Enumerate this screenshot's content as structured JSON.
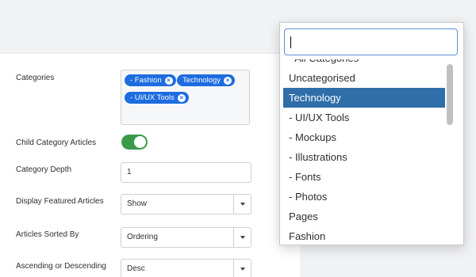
{
  "form": {
    "categories_label": "Categories",
    "tags": [
      {
        "label": "- Fashion"
      },
      {
        "label": "Technology"
      },
      {
        "label": "- UI/UX Tools"
      }
    ],
    "child_articles_label": "Child Category Articles",
    "child_articles_enabled": true,
    "depth_label": "Category Depth",
    "depth_value": "1",
    "featured_label": "Display Featured Articles",
    "featured_value": "Show",
    "sorted_label": "Articles Sorted By",
    "sorted_value": "Ordering",
    "order_label": "Ascending or Descending",
    "order_value": "Desc"
  },
  "dropdown": {
    "search_value": "",
    "items": [
      {
        "label": "- All Categories"
      },
      {
        "label": "Uncategorised"
      },
      {
        "label": "Technology"
      },
      {
        "label": "- UI/UX Tools"
      },
      {
        "label": "- Mockups"
      },
      {
        "label": "- Illustrations"
      },
      {
        "label": "- Fonts"
      },
      {
        "label": "- Photos"
      },
      {
        "label": "Pages"
      },
      {
        "label": "Fashion"
      }
    ],
    "selected": "Technology"
  },
  "colors": {
    "tag": "#1d6ce0",
    "toggle_on": "#3a9a4c",
    "selected_item": "#2f6ea8",
    "search_border": "#5b8fd8"
  }
}
